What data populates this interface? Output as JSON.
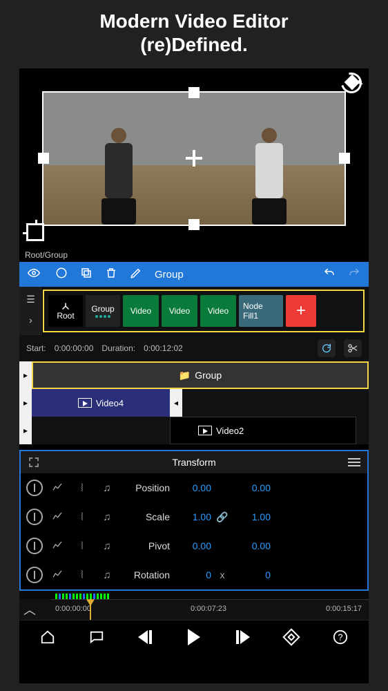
{
  "headline": {
    "line1": "Modern Video Editor",
    "line2": "(re)Defined."
  },
  "breadcrumb": "Root/Group",
  "toolbar": {
    "group_label": "Group"
  },
  "chips": {
    "root_label": "Root",
    "group_label": "Group",
    "video1": "Video",
    "video2": "Video",
    "video3": "Video",
    "node_fill": "Node Fill1",
    "add": "+"
  },
  "timing": {
    "start_label": "Start:",
    "start_value": "0:00:00:00",
    "duration_label": "Duration:",
    "duration_value": "0:00:12:02"
  },
  "tracks": {
    "group_label": "Group",
    "video4": "Video4",
    "video2": "Video2"
  },
  "transform": {
    "title": "Transform",
    "rows": [
      {
        "label": "Position",
        "v1": "0.00",
        "link": "",
        "v2": "0.00"
      },
      {
        "label": "Scale",
        "v1": "1.00",
        "link": "🔗",
        "v2": "1.00"
      },
      {
        "label": "Pivot",
        "v1": "0.00",
        "link": "",
        "v2": "0.00"
      },
      {
        "label": "Rotation",
        "v1": "0",
        "link": "x",
        "v2": "0"
      }
    ]
  },
  "ruler": {
    "t0": "0:00:00:00",
    "t1": "0:00:07:23",
    "t2": "0:00:15:17"
  }
}
